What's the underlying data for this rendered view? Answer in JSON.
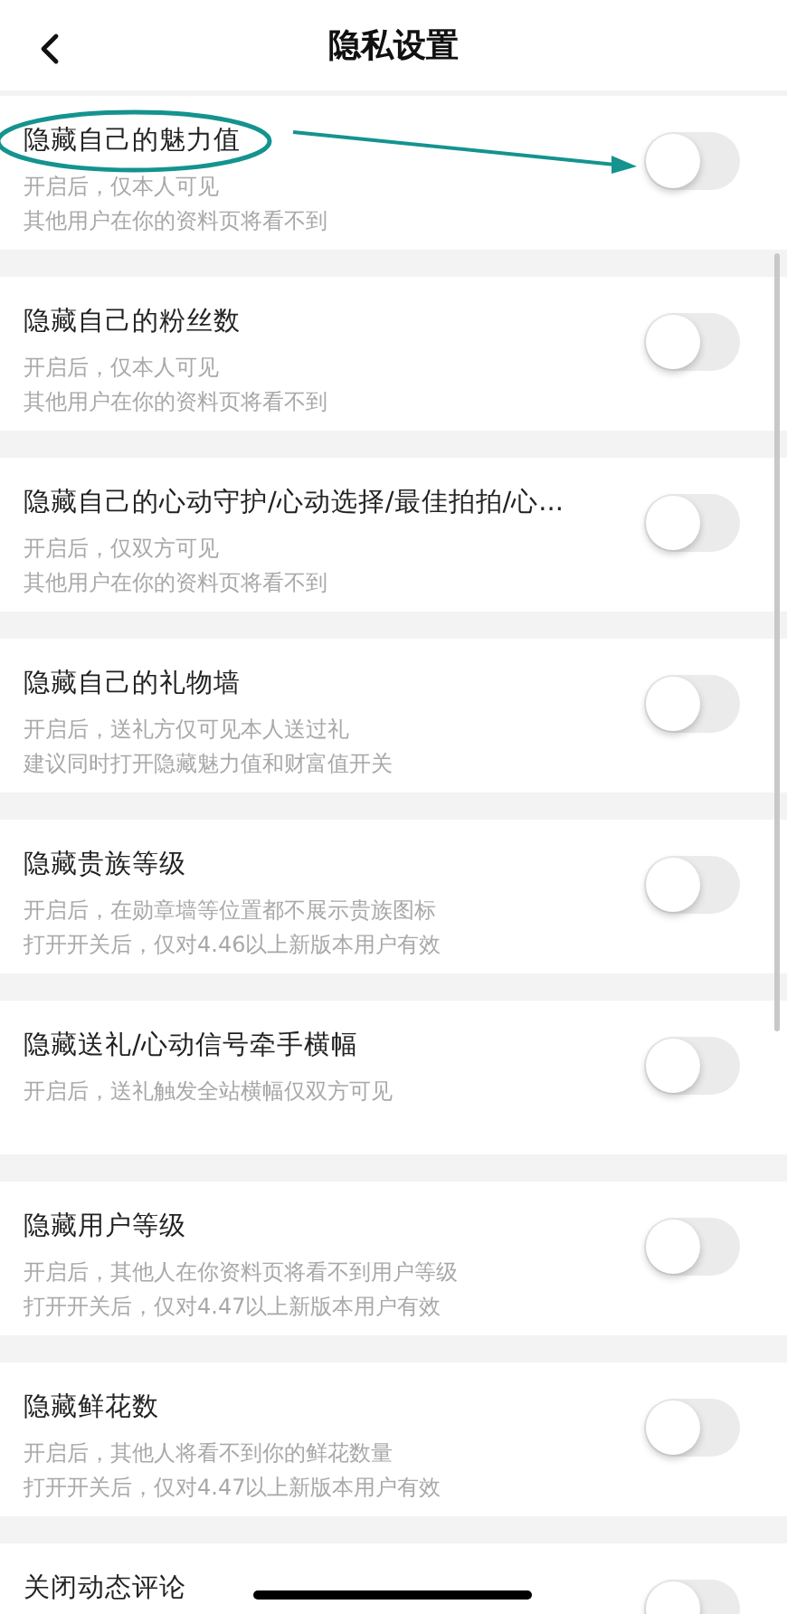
{
  "header": {
    "title": "隐私设置"
  },
  "settings": [
    {
      "title": "隐藏自己的魅力值",
      "lines": [
        "开启后，仅本人可见",
        "其他用户在你的资料页将看不到"
      ],
      "on": false
    },
    {
      "title": "隐藏自己的粉丝数",
      "lines": [
        "开启后，仅本人可见",
        "其他用户在你的资料页将看不到"
      ],
      "on": false
    },
    {
      "title": "隐藏自己的心动守护/心动选择/最佳拍拍/心...",
      "lines": [
        "开启后，仅双方可见",
        "其他用户在你的资料页将看不到"
      ],
      "on": false
    },
    {
      "title": "隐藏自己的礼物墙",
      "lines": [
        "开启后，送礼方仅可见本人送过礼",
        "建议同时打开隐藏魅力值和财富值开关"
      ],
      "on": false
    },
    {
      "title": "隐藏贵族等级",
      "lines": [
        "开启后，在勋章墙等位置都不展示贵族图标",
        "打开开关后，仅对4.46以上新版本用户有效"
      ],
      "on": false
    },
    {
      "title": "隐藏送礼/心动信号牵手横幅",
      "lines": [
        "开启后，送礼触发全站横幅仅双方可见"
      ],
      "on": false
    },
    {
      "title": "隐藏用户等级",
      "lines": [
        "开启后，其他人在你资料页将看不到用户等级",
        "打开开关后，仅对4.47以上新版本用户有效"
      ],
      "on": false
    },
    {
      "title": "隐藏鲜花数",
      "lines": [
        "开启后，其他人将看不到你的鲜花数量",
        "打开开关后，仅对4.47以上新版本用户有效"
      ],
      "on": false
    },
    {
      "title": "关闭动态评论",
      "on": false
    }
  ]
}
